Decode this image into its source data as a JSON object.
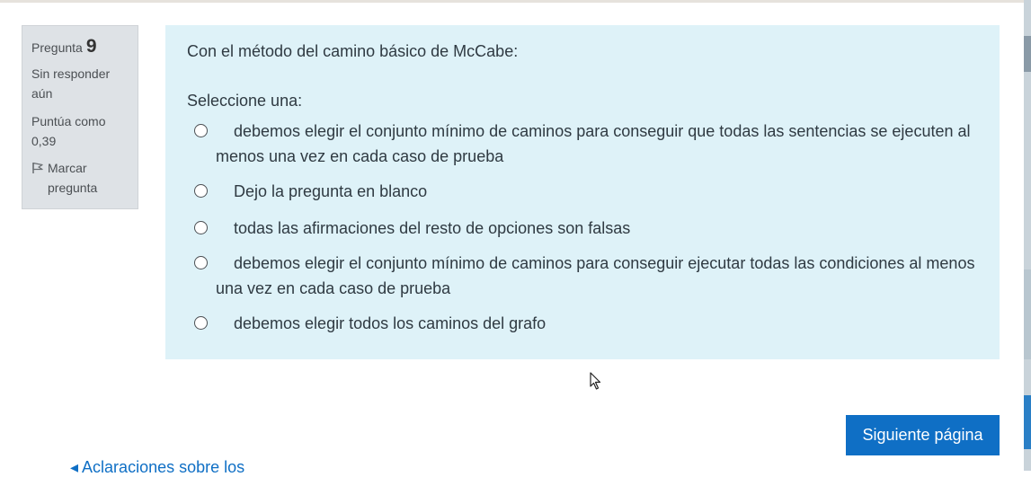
{
  "question": {
    "label": "Pregunta",
    "number": "9",
    "status": "Sin responder aún",
    "grade": "Puntúa como 0,39",
    "flag_label": "Marcar pregunta",
    "text": "Con el método del camino básico de McCabe:",
    "prompt": "Seleccione una:",
    "options": [
      {
        "label": "debemos elegir el conjunto mínimo de caminos para conseguir que todas las sentencias se ejecuten al menos una vez en cada caso de prueba",
        "checked": false
      },
      {
        "label": "Dejo la pregunta en blanco",
        "checked": false
      },
      {
        "label": "todas las afirmaciones del resto de opciones son falsas",
        "checked": false
      },
      {
        "label": "debemos elegir el conjunto mínimo de caminos para conseguir ejecutar todas las condiciones al menos una vez en cada caso de prueba",
        "checked": false
      },
      {
        "label": "debemos elegir todos los caminos del grafo",
        "checked": false
      }
    ]
  },
  "navigation": {
    "next_label": "Siguiente página",
    "prev_link": "◂ Aclaraciones sobre los"
  },
  "colors": {
    "content_bg": "#def2f8",
    "info_bg": "#dee2e6",
    "button_bg": "#0f6fc5",
    "link": "#0f6fc5"
  }
}
